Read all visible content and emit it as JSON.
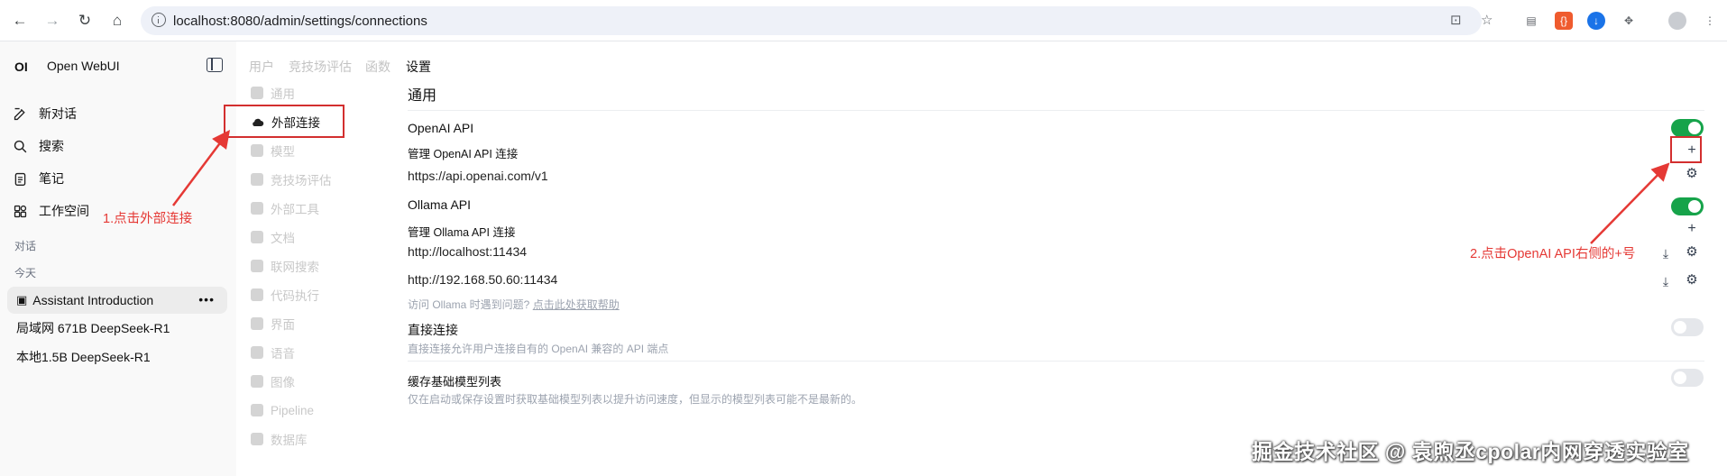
{
  "browser": {
    "url": "localhost:8080/admin/settings/connections"
  },
  "sidebar": {
    "logo": "OI",
    "app_name": "Open WebUI",
    "nav": [
      {
        "label": "新对话",
        "icon": "edit-icon"
      },
      {
        "label": "搜索",
        "icon": "search-icon"
      },
      {
        "label": "笔记",
        "icon": "notes-icon"
      },
      {
        "label": "工作空间",
        "icon": "workspace-icon"
      }
    ],
    "section_chats": "对话",
    "section_today": "今天",
    "chats": [
      {
        "label": "Assistant Introduction",
        "active": true
      },
      {
        "label": "局域网 671B DeepSeek-R1",
        "active": false
      },
      {
        "label": "本地1.5B DeepSeek-R1",
        "active": false
      }
    ],
    "chat_menu": "•••"
  },
  "top_tabs": [
    {
      "label": "用户",
      "active": false
    },
    {
      "label": "竞技场评估",
      "active": false
    },
    {
      "label": "函数",
      "active": false
    },
    {
      "label": "设置",
      "active": true
    }
  ],
  "settings_nav": [
    {
      "label": "通用",
      "active": false
    },
    {
      "label": "外部连接",
      "active": true
    },
    {
      "label": "模型",
      "active": false
    },
    {
      "label": "竞技场评估",
      "active": false
    },
    {
      "label": "外部工具",
      "active": false
    },
    {
      "label": "文档",
      "active": false
    },
    {
      "label": "联网搜索",
      "active": false
    },
    {
      "label": "代码执行",
      "active": false
    },
    {
      "label": "界面",
      "active": false
    },
    {
      "label": "语音",
      "active": false
    },
    {
      "label": "图像",
      "active": false
    },
    {
      "label": "Pipeline",
      "active": false
    },
    {
      "label": "数据库",
      "active": false
    }
  ],
  "main": {
    "title": "通用",
    "openai": {
      "title": "OpenAI API",
      "manage_label": "管理 OpenAI API 连接",
      "urls": [
        "https://api.openai.com/v1"
      ],
      "enabled": true
    },
    "ollama": {
      "title": "Ollama API",
      "manage_label": "管理 Ollama API 连接",
      "urls": [
        "http://localhost:11434",
        "http://192.168.50.60:11434"
      ],
      "enabled": true,
      "help_text": "访问 Ollama 时遇到问题?",
      "help_link": "点击此处获取帮助"
    },
    "direct": {
      "title": "直接连接",
      "desc": "直接连接允许用户连接自有的 OpenAI 兼容的 API 端点",
      "enabled": false
    },
    "cache": {
      "title": "缓存基础模型列表",
      "desc": "仅在启动或保存设置时获取基础模型列表以提升访问速度，但显示的模型列表可能不是最新的。",
      "enabled": false
    },
    "plus_symbol": "+",
    "gear_symbol": "⚙",
    "download_symbol": "⤓"
  },
  "annotations": {
    "step1": "1.点击外部连接",
    "step2": "2.点击OpenAI API右侧的+号"
  },
  "watermark": "掘金技术社区 @ 袁煦丞cpolar内网穿透实验室",
  "colors": {
    "toggle_on": "#16a34a",
    "annotation": "#e53935"
  }
}
